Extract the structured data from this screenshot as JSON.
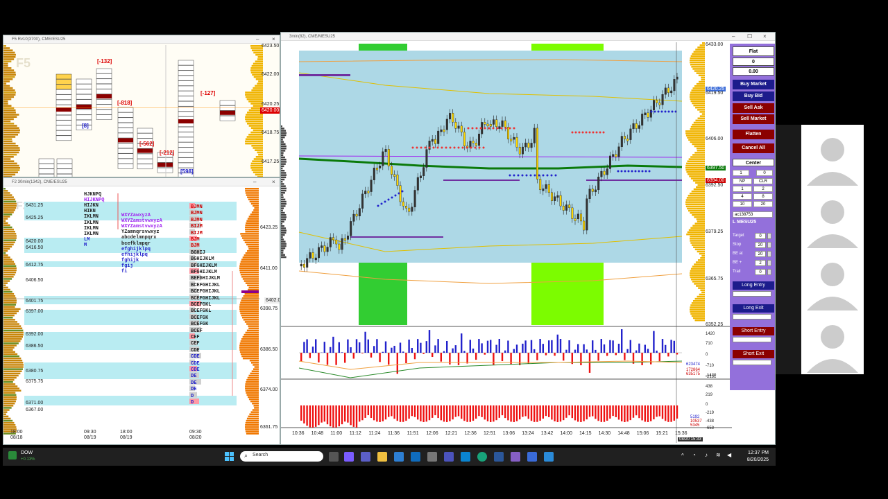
{
  "windows": {
    "f5": {
      "title": "F5 Rv10(3700), CME/ESU25",
      "watermark": "F5",
      "prices": [
        "6423.50",
        "6422.00",
        "6420.25",
        "6420.00",
        "6418.75",
        "6417.25"
      ],
      "price_active": "6420.00",
      "delta_labels": [
        "[-132]",
        "[8]",
        "[-818]",
        "[-562]",
        "[-212]",
        "[-127]",
        "[598]"
      ]
    },
    "f2": {
      "title": "F2 30min(1342), CME/ESU25",
      "watermark": "F2",
      "left_prices": [
        "6431.25",
        "6425.25",
        "6420.00",
        "6416.50",
        "6412.75",
        "6406.50",
        "6401.75",
        "6397.00",
        "6392.00",
        "6386.50",
        "6380.75",
        "6375.75",
        "6371.00",
        "6367.00"
      ],
      "right_prices": [
        "6423.25",
        "6411.00",
        "6398.75",
        "6386.50",
        "6374.00",
        "6361.75"
      ],
      "right_active": "6402.00",
      "tpo_rows": [
        "HJKNPQ",
        "HIJKNPQ",
        "HIJKN",
        "HIKN",
        "IKLMN",
        "IKLMN",
        "IKLMN",
        "IKLMN",
        "LM",
        "M"
      ],
      "tpo_rows_b": [
        "WXYZawxyzA",
        "WXYZamstvwxyzA",
        "WXYZamstvwxyzA",
        "YZamnqrsvwxyz",
        "abcdelmnpqrx",
        "bcefklmpqr",
        "efghijklpq",
        "efhijklpq",
        "fghijk",
        "fgij",
        "fi"
      ],
      "tpo_rows_c": [
        "BJMN",
        "BJMN",
        "BJMN",
        "BIJM",
        "BIJM",
        "BJM",
        "BJM",
        "BGHIJ",
        "BGHIJKLM",
        "BFGHIJKLM",
        "BFGHIJKLM",
        "BEFGHIJKLM",
        "BCEFGHIJKL",
        "BCEFGHIJKL",
        "BCEFGHIJKL",
        "BCEFGKL",
        "BCEFGKL",
        "BCEFGK",
        "BCEFGK",
        "BCEF",
        "CEF",
        "CEF",
        "CDE",
        "CDE",
        "CDE",
        "CDE",
        "DE",
        "DE",
        "DE",
        "D",
        "D"
      ],
      "time_labels": [
        {
          "t": "18:00",
          "d": "08/18"
        },
        {
          "t": "09:30",
          "d": "08/19"
        },
        {
          "t": "18:00",
          "d": "08/19"
        },
        {
          "t": "09:30",
          "d": "08/20"
        }
      ]
    },
    "main": {
      "title": "3min(82), CME/MESU25",
      "right_prices": [
        "6433.00",
        "6420.25",
        "6419.50",
        "6406.00",
        "6397.50",
        "6394.00",
        "6392.50",
        "6379.25",
        "6365.75",
        "6352.25"
      ],
      "price_current": "6420.25",
      "price_green": "6397.50",
      "price_red": "6394.00",
      "volume_axis": [
        "1420",
        "710",
        "0",
        "-710",
        "-1420",
        "-2131"
      ],
      "volume_readouts": [
        "623474",
        "172864",
        "635175"
      ],
      "delta_axis": [
        "438",
        "219",
        "0",
        "-219",
        "-438",
        "-658"
      ],
      "delta_readouts": [
        "5192",
        "10537",
        "5345"
      ],
      "time_axis": [
        "10:36",
        "10:48",
        "11:00",
        "11:12",
        "11:24",
        "11:36",
        "11:51",
        "12:06",
        "12:21",
        "12:36",
        "12:51",
        "13:06",
        "13:24",
        "13:42",
        "14:00",
        "14:15",
        "14:30",
        "14:48",
        "15:06",
        "15:21",
        "15:36"
      ],
      "time_cursor": "08/20 15:33"
    }
  },
  "trade_panel": {
    "status": "Flat",
    "position": "0",
    "pnl": "0.00",
    "buy_market": "Buy Market",
    "buy_bid": "Buy Bid",
    "sell_ask": "Sell Ask",
    "sell_market": "Sell Market",
    "flatten": "Flatten",
    "cancel_all": "Cancel All",
    "center": "Center",
    "qty_value": "1",
    "qty_right": "0",
    "grid": [
      "NP",
      "CLR",
      "1",
      "2",
      "4",
      "8",
      "10",
      "20"
    ],
    "account": "ac138753",
    "symbol": "L MESU25",
    "params": [
      {
        "label": "Target",
        "value": "0"
      },
      {
        "label": "Stop",
        "value": "20"
      },
      {
        "label": "BE at",
        "value": "20"
      },
      {
        "label": "BE +",
        "value": "2"
      },
      {
        "label": "Trail",
        "value": "0"
      }
    ],
    "long_entry": "Long Entry",
    "long_exit": "Long Exit",
    "short_entry": "Short Entry",
    "short_exit": "Short Exit"
  },
  "taskbar": {
    "ticker": "DOW",
    "ticker_change": "+0.13%",
    "search_placeholder": "Search",
    "time": "12:37 PM",
    "date": "8/20/2025"
  },
  "colors": {
    "panel_bg": "#9370db",
    "blue_btn": "#1c1c8c",
    "red_btn": "#8b0000",
    "chart_bg": "#add8e6",
    "green_zone": "#32cd32",
    "lime_zone": "#7cfc00"
  }
}
